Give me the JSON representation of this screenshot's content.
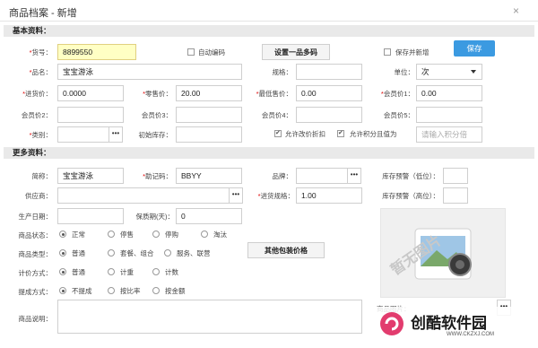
{
  "window": {
    "title": "商品档案 - 新增",
    "close_glyph": "×"
  },
  "basic": {
    "heading": "基本资料：",
    "code_label": "货号：",
    "code_value": "8899550",
    "auto_code_label": "自动编码",
    "one_item_multi_code_button": "设置一品多码",
    "save_and_new_label": "保存并新增",
    "save_button": "保存",
    "name_label": "品名：",
    "name_value": "宝宝游泳",
    "spec_label": "规格：",
    "spec_value": "",
    "unit_label": "单位：",
    "unit_value": "次",
    "purchase_price_label": "进货价：",
    "purchase_price_value": "0.0000",
    "retail_price_label": "零售价：",
    "retail_price_value": "20.00",
    "min_price_label": "最低售价：",
    "min_price_value": "0.00",
    "member1_label": "会员价1：",
    "member1_value": "0.00",
    "member2_label": "会员价2：",
    "member3_label": "会员价3：",
    "member4_label": "会员价4：",
    "member5_label": "会员价5：",
    "category_label": "类别：",
    "initial_stock_label": "初始库存：",
    "allow_discount_label": "允许改价折扣",
    "allow_points_label": "允许积分且值为",
    "points_placeholder": "请输入积分倍"
  },
  "more": {
    "heading": "更多资料：",
    "abbr_label": "简称：",
    "abbr_value": "宝宝游泳",
    "mnemonic_label": "助记码：",
    "mnemonic_value": "BBYY",
    "brand_label": "品牌：",
    "stock_warn_low_label": "库存预警（低位）：",
    "supplier_label": "供应商：",
    "purchase_spec_label": "进货规格：",
    "purchase_spec_value": "1.00",
    "stock_warn_high_label": "库存预警（高位）：",
    "production_date_label": "生产日期：",
    "shelf_life_label": "保质期(天)：",
    "shelf_life_value": "0",
    "status_label": "商品状态：",
    "status_options": [
      "正常",
      "停售",
      "停购",
      "淘汰"
    ],
    "type_label": "商品类型：",
    "type_options": [
      "普通",
      "套餐、组合",
      "服务、联营"
    ],
    "other_pack_price_button": "其他包装价格",
    "pricing_label": "计价方式：",
    "pricing_options": [
      "普通",
      "计重",
      "计数"
    ],
    "commission_label": "提成方式：",
    "commission_options": [
      "不提成",
      "按比率",
      "按金额"
    ],
    "desc_label": "商品说明：",
    "image_label": "商品图片：",
    "image_placeholder_text": "暂无图片"
  },
  "watermark": {
    "brand": "创酷软件园",
    "url": "WWW.CKZXJ.COM"
  },
  "colors": {
    "required": "#dd0000",
    "accent_blue": "#3b9ae1",
    "highlight_yellow": "#ffffc4",
    "section_gray": "#e9e9e9",
    "brand_pink": "#e23c6e"
  }
}
